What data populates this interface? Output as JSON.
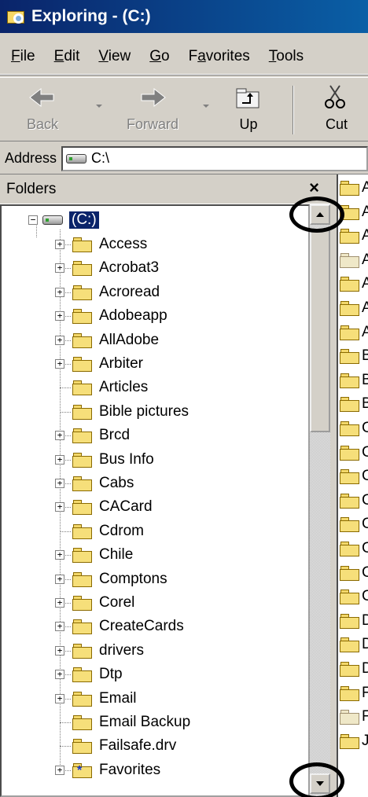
{
  "window": {
    "title": "Exploring - (C:)"
  },
  "menu": [
    "File",
    "Edit",
    "View",
    "Go",
    "Favorites",
    "Tools"
  ],
  "menu_underline": [
    "F",
    "E",
    "V",
    "G",
    "a",
    "T"
  ],
  "toolbar": {
    "back": "Back",
    "forward": "Forward",
    "up": "Up",
    "cut": "Cut"
  },
  "address": {
    "label": "Address",
    "value": "C:\\"
  },
  "folders": {
    "title": "Folders",
    "close": "×",
    "root": "(C:)",
    "items": [
      {
        "label": "Access",
        "expandable": true
      },
      {
        "label": "Acrobat3",
        "expandable": true
      },
      {
        "label": "Acroread",
        "expandable": true
      },
      {
        "label": "Adobeapp",
        "expandable": true
      },
      {
        "label": "AllAdobe",
        "expandable": true
      },
      {
        "label": "Arbiter",
        "expandable": true
      },
      {
        "label": "Articles",
        "expandable": false
      },
      {
        "label": "Bible pictures",
        "expandable": false
      },
      {
        "label": "Brcd",
        "expandable": true
      },
      {
        "label": "Bus Info",
        "expandable": true
      },
      {
        "label": "Cabs",
        "expandable": true
      },
      {
        "label": "CACard",
        "expandable": true
      },
      {
        "label": "Cdrom",
        "expandable": false
      },
      {
        "label": "Chile",
        "expandable": true
      },
      {
        "label": "Comptons",
        "expandable": true
      },
      {
        "label": "Corel",
        "expandable": true
      },
      {
        "label": "CreateCards",
        "expandable": true
      },
      {
        "label": "drivers",
        "expandable": true
      },
      {
        "label": "Dtp",
        "expandable": true
      },
      {
        "label": "Email",
        "expandable": true
      },
      {
        "label": "Email Backup",
        "expandable": false
      },
      {
        "label": "Failsafe.drv",
        "expandable": false
      },
      {
        "label": "Favorites",
        "expandable": true
      }
    ]
  },
  "contents": {
    "items": [
      "A",
      "A",
      "A",
      "A",
      "A",
      "A",
      "A",
      "B",
      "B",
      "B",
      "C",
      "C",
      "C",
      "C",
      "C",
      "C",
      "C",
      "C",
      "D",
      "D",
      "D",
      "F",
      "F",
      "J"
    ]
  }
}
